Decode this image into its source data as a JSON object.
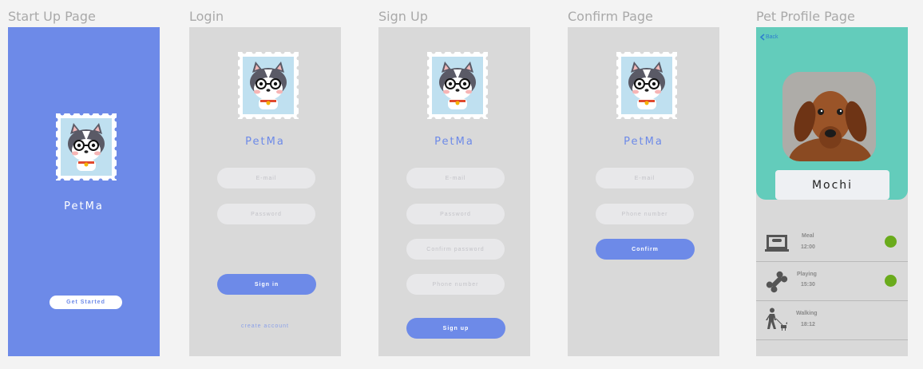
{
  "frames": {
    "startup": {
      "title": "Start Up Page",
      "brand": "PetMa",
      "button": "Get Started"
    },
    "login": {
      "title": "Login",
      "brand": "PetMa",
      "email_placeholder": "E-mail",
      "password_placeholder": "Password",
      "button": "Sign in",
      "link": "create account"
    },
    "signup": {
      "title": "Sign Up",
      "brand": "PetMa",
      "email_placeholder": "E-mail",
      "password_placeholder": "Password",
      "confirm_placeholder": "Confirm password",
      "phone_placeholder": "Phone number",
      "button": "Sign up"
    },
    "confirm": {
      "title": "Confirm Page",
      "brand": "PetMa",
      "email_placeholder": "E-mail",
      "phone_placeholder": "Phone number",
      "button": "Confirm"
    },
    "profile": {
      "title": "Pet Profile Page",
      "back": "Back",
      "pet_name": "Mochi",
      "activities": [
        {
          "name": "Meal",
          "time": "12:00",
          "icon": "food-bowl-icon",
          "done": true
        },
        {
          "name": "Playing",
          "time": "15:30",
          "icon": "bone-icon",
          "done": true
        },
        {
          "name": "Walking",
          "time": "18:12",
          "icon": "dog-walking-icon",
          "done": false
        }
      ]
    }
  },
  "colors": {
    "primary": "#6d8ae8",
    "frame_gray": "#d9d9d9",
    "teal": "#63ccbb",
    "status_green": "#6aab1c"
  }
}
